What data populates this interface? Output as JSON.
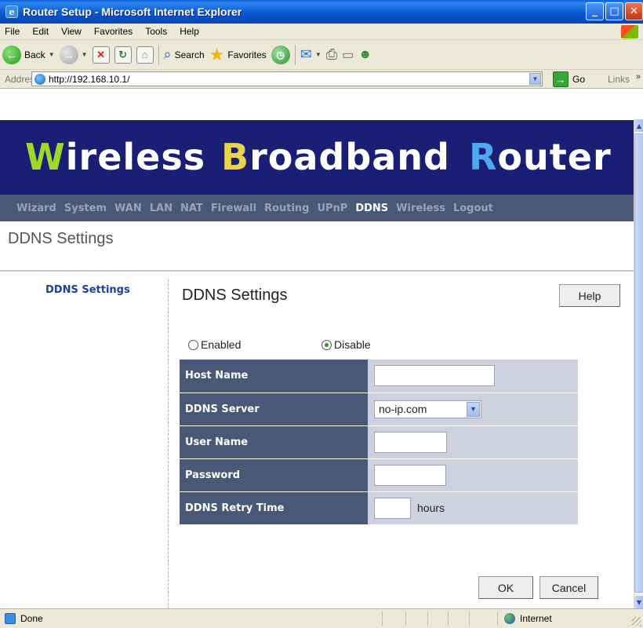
{
  "window": {
    "title": "Router Setup - Microsoft Internet Explorer",
    "controls": [
      "minimize",
      "maximize",
      "close"
    ]
  },
  "menu": [
    "File",
    "Edit",
    "View",
    "Favorites",
    "Tools",
    "Help"
  ],
  "toolbar": {
    "back": "Back",
    "search": "Search",
    "favorites": "Favorites"
  },
  "address": {
    "label": "Address",
    "url": "http://192.168.10.1/",
    "go": "Go",
    "links": "Links"
  },
  "banner": {
    "words": [
      {
        "cap": "W",
        "rest": "ireless"
      },
      {
        "cap": "B",
        "rest": "roadband"
      },
      {
        "cap": "R",
        "rest": "outer"
      }
    ],
    "colors": {
      "background": "#1a1e74",
      "cap_w": "#9fd92b",
      "cap_b": "#e8d44a",
      "cap_r": "#4fa7f0"
    }
  },
  "nav": {
    "items": [
      "Wizard",
      "System",
      "WAN",
      "LAN",
      "NAT",
      "Firewall",
      "Routing",
      "UPnP",
      "DDNS",
      "Wireless",
      "Logout"
    ],
    "active": "DDNS"
  },
  "page": {
    "title": "DDNS Settings",
    "sidebar_link": "DDNS Settings",
    "section_title": "DDNS Settings",
    "help": "Help"
  },
  "ddns": {
    "enabled_label": "Enabled",
    "disable_label": "Disable",
    "selected": "Disable",
    "fields": {
      "host_name": {
        "label": "Host Name",
        "value": ""
      },
      "ddns_server": {
        "label": "DDNS Server",
        "value": "no-ip.com"
      },
      "user_name": {
        "label": "User Name",
        "value": ""
      },
      "password": {
        "label": "Password",
        "value": ""
      },
      "retry_time": {
        "label": "DDNS Retry Time",
        "value": "",
        "unit": "hours"
      }
    },
    "ok": "OK",
    "cancel": "Cancel"
  },
  "status": {
    "left": "Done",
    "zone": "Internet"
  }
}
